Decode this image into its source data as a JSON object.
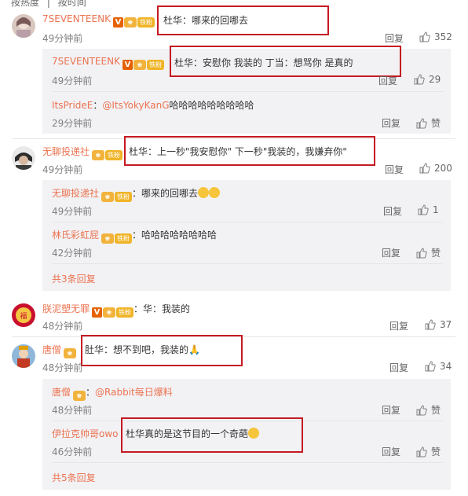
{
  "sort_bar": {
    "hot": "按热度",
    "time": "按时间"
  },
  "labels": {
    "reply": "回复",
    "like": "赞"
  },
  "badges": {
    "fan": "铁粉"
  },
  "comments": [
    {
      "username": "7SEVENTEENK",
      "text": "杜华：哪来的回哪去",
      "time": "49分钟前",
      "likes": "352",
      "replies": [
        {
          "username": "7SEVENTEENK",
          "text": "杜华：安慰你 我装的 丁当：想骂你 是真的",
          "time": "49分钟前",
          "likes": "29"
        },
        {
          "username": "ItsPrideE",
          "mention": "@ItsYokyKanG",
          "text": "哈哈哈哈哈哈哈哈哈",
          "time": "29分钟前"
        }
      ]
    },
    {
      "username": "无聊投递社",
      "text": "杜华：上一秒\"我安慰你\" 下一秒\"我装的，我嫌弃你\"",
      "time": "49分钟前",
      "likes": "200",
      "replies": [
        {
          "username": "无聊投递社",
          "text": "哪来的回哪去",
          "time": "49分钟前",
          "likes": "1"
        },
        {
          "username": "林氏彩虹屁",
          "text": "哈哈哈哈哈哈哈哈",
          "time": "42分钟前"
        }
      ],
      "more": "共3条回复"
    },
    {
      "username": "朕泥塑无罪",
      "text": "华：我装的",
      "time": "48分钟前",
      "likes": "37"
    },
    {
      "username": "唐僧",
      "text": "肚华：想不到吧，我装的",
      "time": "48分钟前",
      "likes": "34",
      "replies": [
        {
          "username": "唐僧",
          "mention": "@Rabbit每日爆料",
          "text": "",
          "time": "48分钟前"
        },
        {
          "username": "伊拉克帅哥owo",
          "text": "杜华真的是这节目的一个奇葩",
          "time": "46分钟前"
        }
      ],
      "more": "共5条回复"
    }
  ]
}
